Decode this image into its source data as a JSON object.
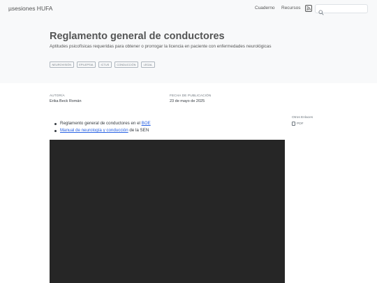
{
  "header": {
    "brand": "µsesiones HUFA",
    "nav": [
      "Cuaderno",
      "Recursos"
    ],
    "rss_icon": "rss-icon",
    "search_icon": "search-icon",
    "search_placeholder": ""
  },
  "banner": {
    "title": "Reglamento general de conductores",
    "subtitle": "Aptitudes psicofísicas requeridas para obtener o prorrogar la licencia en paciente con enfermedades neurológicas",
    "tags": [
      "NEUROVISIÓN",
      "EPILEPSIA",
      "ICTUS",
      "CONDUCCIÓN",
      "LEGAL"
    ]
  },
  "meta": {
    "author_label": "AUTOR/A",
    "author": "Erika Beck Román",
    "date_label": "FECHA DE PUBLICACIÓN",
    "date": "23 de mayo de 2025"
  },
  "content": {
    "item1_text": "Reglamento general de conductores en el ",
    "item1_link": "BOE",
    "item2_link": "Manual de neurología y conducción",
    "item2_text": " de la SEN"
  },
  "sidebar": {
    "title": "Otros Enlaces",
    "pdf_label": "PDF",
    "pdf_icon": "file-pdf-icon"
  },
  "colors": {
    "banner_bg": "#f8f9fa",
    "link": "#2761e3",
    "video_bg": "#262626"
  }
}
